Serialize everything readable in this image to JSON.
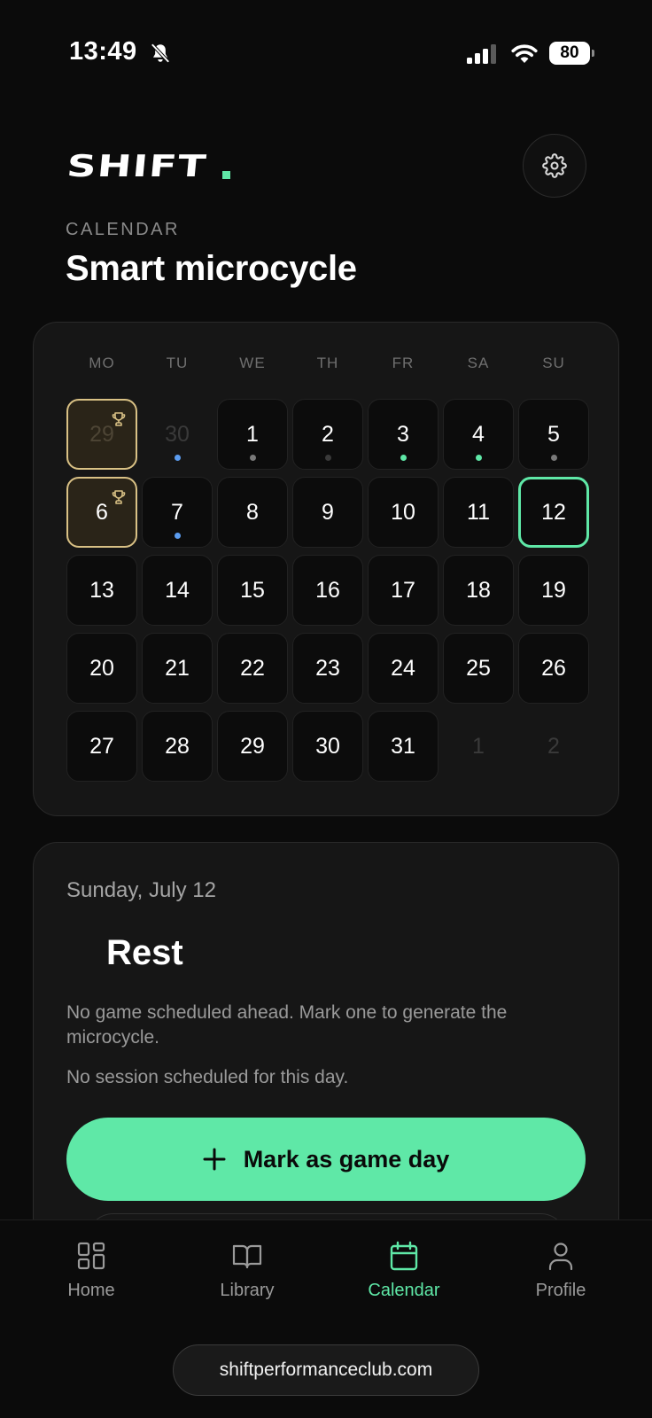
{
  "status_bar": {
    "time": "13:49",
    "battery": "80"
  },
  "header": {
    "logo": "SHIFT",
    "eyebrow": "CALENDAR",
    "title": "Smart microcycle"
  },
  "calendar": {
    "weekdays": [
      "MO",
      "TU",
      "WE",
      "TH",
      "FR",
      "SA",
      "SU"
    ],
    "days": [
      {
        "label": "29",
        "outside": true,
        "game": true
      },
      {
        "label": "30",
        "outside": true,
        "dot": "#5b9cf0"
      },
      {
        "label": "1",
        "dot": "#7a7a7a"
      },
      {
        "label": "2",
        "dot": "#3a3a3a"
      },
      {
        "label": "3",
        "dot": "#5fe8a7"
      },
      {
        "label": "4",
        "dot": "#5fe8a7"
      },
      {
        "label": "5",
        "dot": "#7a7a7a"
      },
      {
        "label": "6",
        "game": true
      },
      {
        "label": "7",
        "dot": "#5b9cf0"
      },
      {
        "label": "8"
      },
      {
        "label": "9"
      },
      {
        "label": "10"
      },
      {
        "label": "11"
      },
      {
        "label": "12",
        "today": true
      },
      {
        "label": "13"
      },
      {
        "label": "14"
      },
      {
        "label": "15"
      },
      {
        "label": "16"
      },
      {
        "label": "17"
      },
      {
        "label": "18"
      },
      {
        "label": "19"
      },
      {
        "label": "20"
      },
      {
        "label": "21"
      },
      {
        "label": "22"
      },
      {
        "label": "23"
      },
      {
        "label": "24"
      },
      {
        "label": "25"
      },
      {
        "label": "26"
      },
      {
        "label": "27"
      },
      {
        "label": "28"
      },
      {
        "label": "29"
      },
      {
        "label": "30"
      },
      {
        "label": "31"
      },
      {
        "label": "1",
        "outside": true
      },
      {
        "label": "2",
        "outside": true
      }
    ]
  },
  "detail": {
    "date": "Sunday, July 12",
    "title": "Rest",
    "message": "No game scheduled ahead. Mark one to generate the microcycle.",
    "session_message": "No session scheduled for this day.",
    "primary_button": "Mark as game day"
  },
  "nav": {
    "items": [
      {
        "label": "Home",
        "icon": "home-grid-icon"
      },
      {
        "label": "Library",
        "icon": "book-icon"
      },
      {
        "label": "Calendar",
        "icon": "calendar-icon",
        "active": true
      },
      {
        "label": "Profile",
        "icon": "person-icon"
      }
    ]
  },
  "browser": {
    "url": "shiftperformanceclub.com"
  },
  "colors": {
    "accent": "#5fe8a7",
    "game": "#d9c185",
    "blue_dot": "#5b9cf0",
    "background": "#0b0b0b"
  }
}
